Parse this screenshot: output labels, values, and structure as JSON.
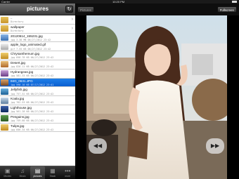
{
  "status": {
    "carrier": "Carrier",
    "time": "10:20 PM"
  },
  "nav": {
    "title": "pictures",
    "refresh_icon": "refresh-icon"
  },
  "files": [
    {
      "name": "..",
      "meta": "Directory",
      "type": "folder",
      "thumb": "folder",
      "chevron": "›"
    },
    {
      "name": "wallpaper",
      "meta": "Directory",
      "type": "folder",
      "thumb": "folder",
      "chevron": "›"
    },
    {
      "name": "20120614_155231.jpg",
      "meta": "jpg  3.38 MB  06/27/2012 23:42",
      "type": "image",
      "thumb": "img1"
    },
    {
      "name": "apple_logo_animated.gif",
      "meta": "gif  7.55 KB  06/27/2012 23:42",
      "type": "image",
      "thumb": "img5"
    },
    {
      "name": "Chrysanthemum.jpg",
      "meta": "jpg  858.78 KB  06/27/2012 23:42",
      "type": "image",
      "thumb": "img3"
    },
    {
      "name": "Desert.jpg",
      "meta": "jpg  826.11 KB  06/27/2012 23:42",
      "type": "image",
      "thumb": "img2"
    },
    {
      "name": "Hydrangeas.jpg",
      "meta": "jpg  581.33 KB  06/27/2012 23:42",
      "type": "image",
      "thumb": "img10"
    },
    {
      "name": "IMG_0631.JPG",
      "meta": "jpg  590.16 KB  07/17/2012 23:41",
      "type": "image",
      "thumb": "img4",
      "selected": true
    },
    {
      "name": "Jellyfish.jpg",
      "meta": "jpg  757.52 KB  06/27/2012 23:42",
      "type": "image",
      "thumb": "img6"
    },
    {
      "name": "Koala.jpg",
      "meta": "jpg  762.53 KB  06/27/2012 23:42",
      "type": "image",
      "thumb": "img8"
    },
    {
      "name": "Lighthouse.jpg",
      "meta": "jpg  561.28 KB  06/27/2012 23:42",
      "type": "image",
      "thumb": "img9"
    },
    {
      "name": "Penguins.jpg",
      "meta": "jpg  759.60 KB  06/27/2012 23:42",
      "type": "image",
      "thumb": "img7"
    },
    {
      "name": "Tulips.jpg",
      "meta": "jpg  606.34 KB  06/27/2012 23:42",
      "type": "image",
      "thumb": "img3"
    }
  ],
  "tabs": [
    {
      "label": "Movies",
      "icon": "film-icon",
      "glyph": "▣"
    },
    {
      "label": "Music",
      "icon": "headphones-icon",
      "glyph": "♫"
    },
    {
      "label": "pictures",
      "icon": "pictures-icon",
      "glyph": "▤",
      "active": true
    },
    {
      "label": "Stack",
      "icon": "stack-icon",
      "glyph": "▦"
    },
    {
      "label": "more",
      "icon": "more-icon",
      "glyph": "•••"
    }
  ],
  "viewer": {
    "back_label": "Pictures",
    "fullscreen_label": "Fullscreen",
    "prev_icon": "rewind-icon",
    "next_icon": "fast-forward-icon",
    "prev_glyph": "◀◀",
    "next_glyph": "▶▶"
  }
}
